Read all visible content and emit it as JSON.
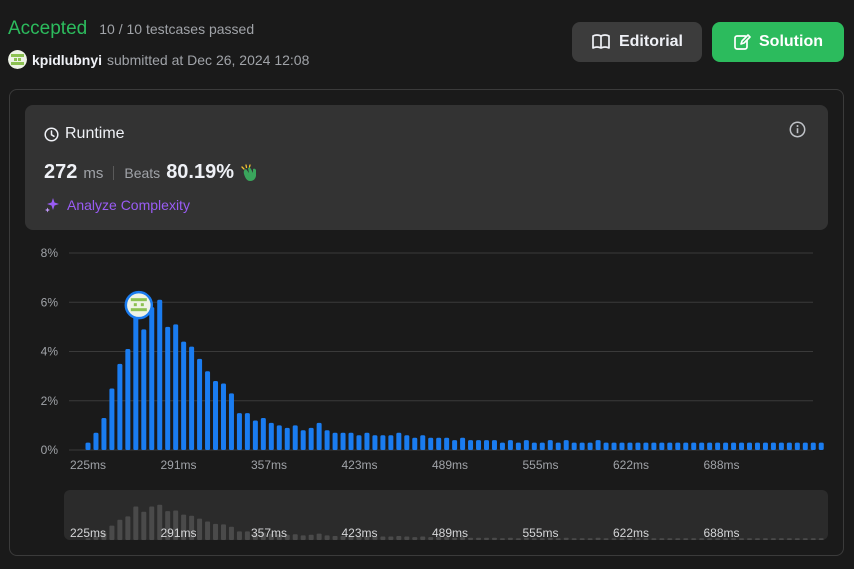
{
  "status": {
    "title": "Accepted",
    "testcases": "10 / 10 testcases passed"
  },
  "submission": {
    "username": "kpidlubnyi",
    "submitted_text": "submitted at Dec 26, 2024 12:08"
  },
  "buttons": {
    "editorial": "Editorial",
    "solution": "Solution"
  },
  "runtime": {
    "label": "Runtime",
    "value": "272",
    "unit": "ms",
    "beats_label": "Beats",
    "beats_value": "80.19%",
    "analyze_label": "Analyze Complexity"
  },
  "colors": {
    "accent_green": "#2cbb5d",
    "bar_blue": "#1a7cf0",
    "purple": "#9a5cf5"
  },
  "icons": [
    "book-icon",
    "edit-icon",
    "clock-icon",
    "info-icon",
    "clap-icon",
    "sparkle-icon"
  ],
  "chart_data": {
    "type": "bar",
    "ylabel_ticks": [
      "0%",
      "2%",
      "4%",
      "6%",
      "8%"
    ],
    "ylim": [
      0,
      8
    ],
    "x_tick_labels": [
      "225ms",
      "291ms",
      "357ms",
      "423ms",
      "489ms",
      "555ms",
      "622ms",
      "688ms"
    ],
    "user_marker_bar": 6,
    "values": [
      0.3,
      0.7,
      1.3,
      2.5,
      3.5,
      4.1,
      5.8,
      4.9,
      5.8,
      6.1,
      5.0,
      5.1,
      4.4,
      4.2,
      3.7,
      3.2,
      2.8,
      2.7,
      2.3,
      1.5,
      1.5,
      1.2,
      1.3,
      1.1,
      1.0,
      0.9,
      1.0,
      0.8,
      0.9,
      1.1,
      0.8,
      0.7,
      0.7,
      0.7,
      0.6,
      0.7,
      0.6,
      0.6,
      0.6,
      0.7,
      0.6,
      0.5,
      0.6,
      0.5,
      0.5,
      0.5,
      0.4,
      0.5,
      0.4,
      0.4,
      0.4,
      0.4,
      0.3,
      0.4,
      0.3,
      0.4,
      0.3,
      0.3,
      0.4,
      0.3,
      0.4,
      0.3,
      0.3,
      0.3,
      0.4,
      0.3,
      0.3,
      0.3,
      0.3,
      0.3,
      0.3,
      0.3,
      0.3,
      0.3,
      0.3,
      0.3,
      0.3,
      0.3,
      0.3,
      0.3,
      0.3,
      0.3,
      0.3,
      0.3,
      0.3,
      0.3,
      0.3,
      0.3,
      0.3,
      0.3,
      0.3,
      0.3,
      0.3
    ]
  }
}
